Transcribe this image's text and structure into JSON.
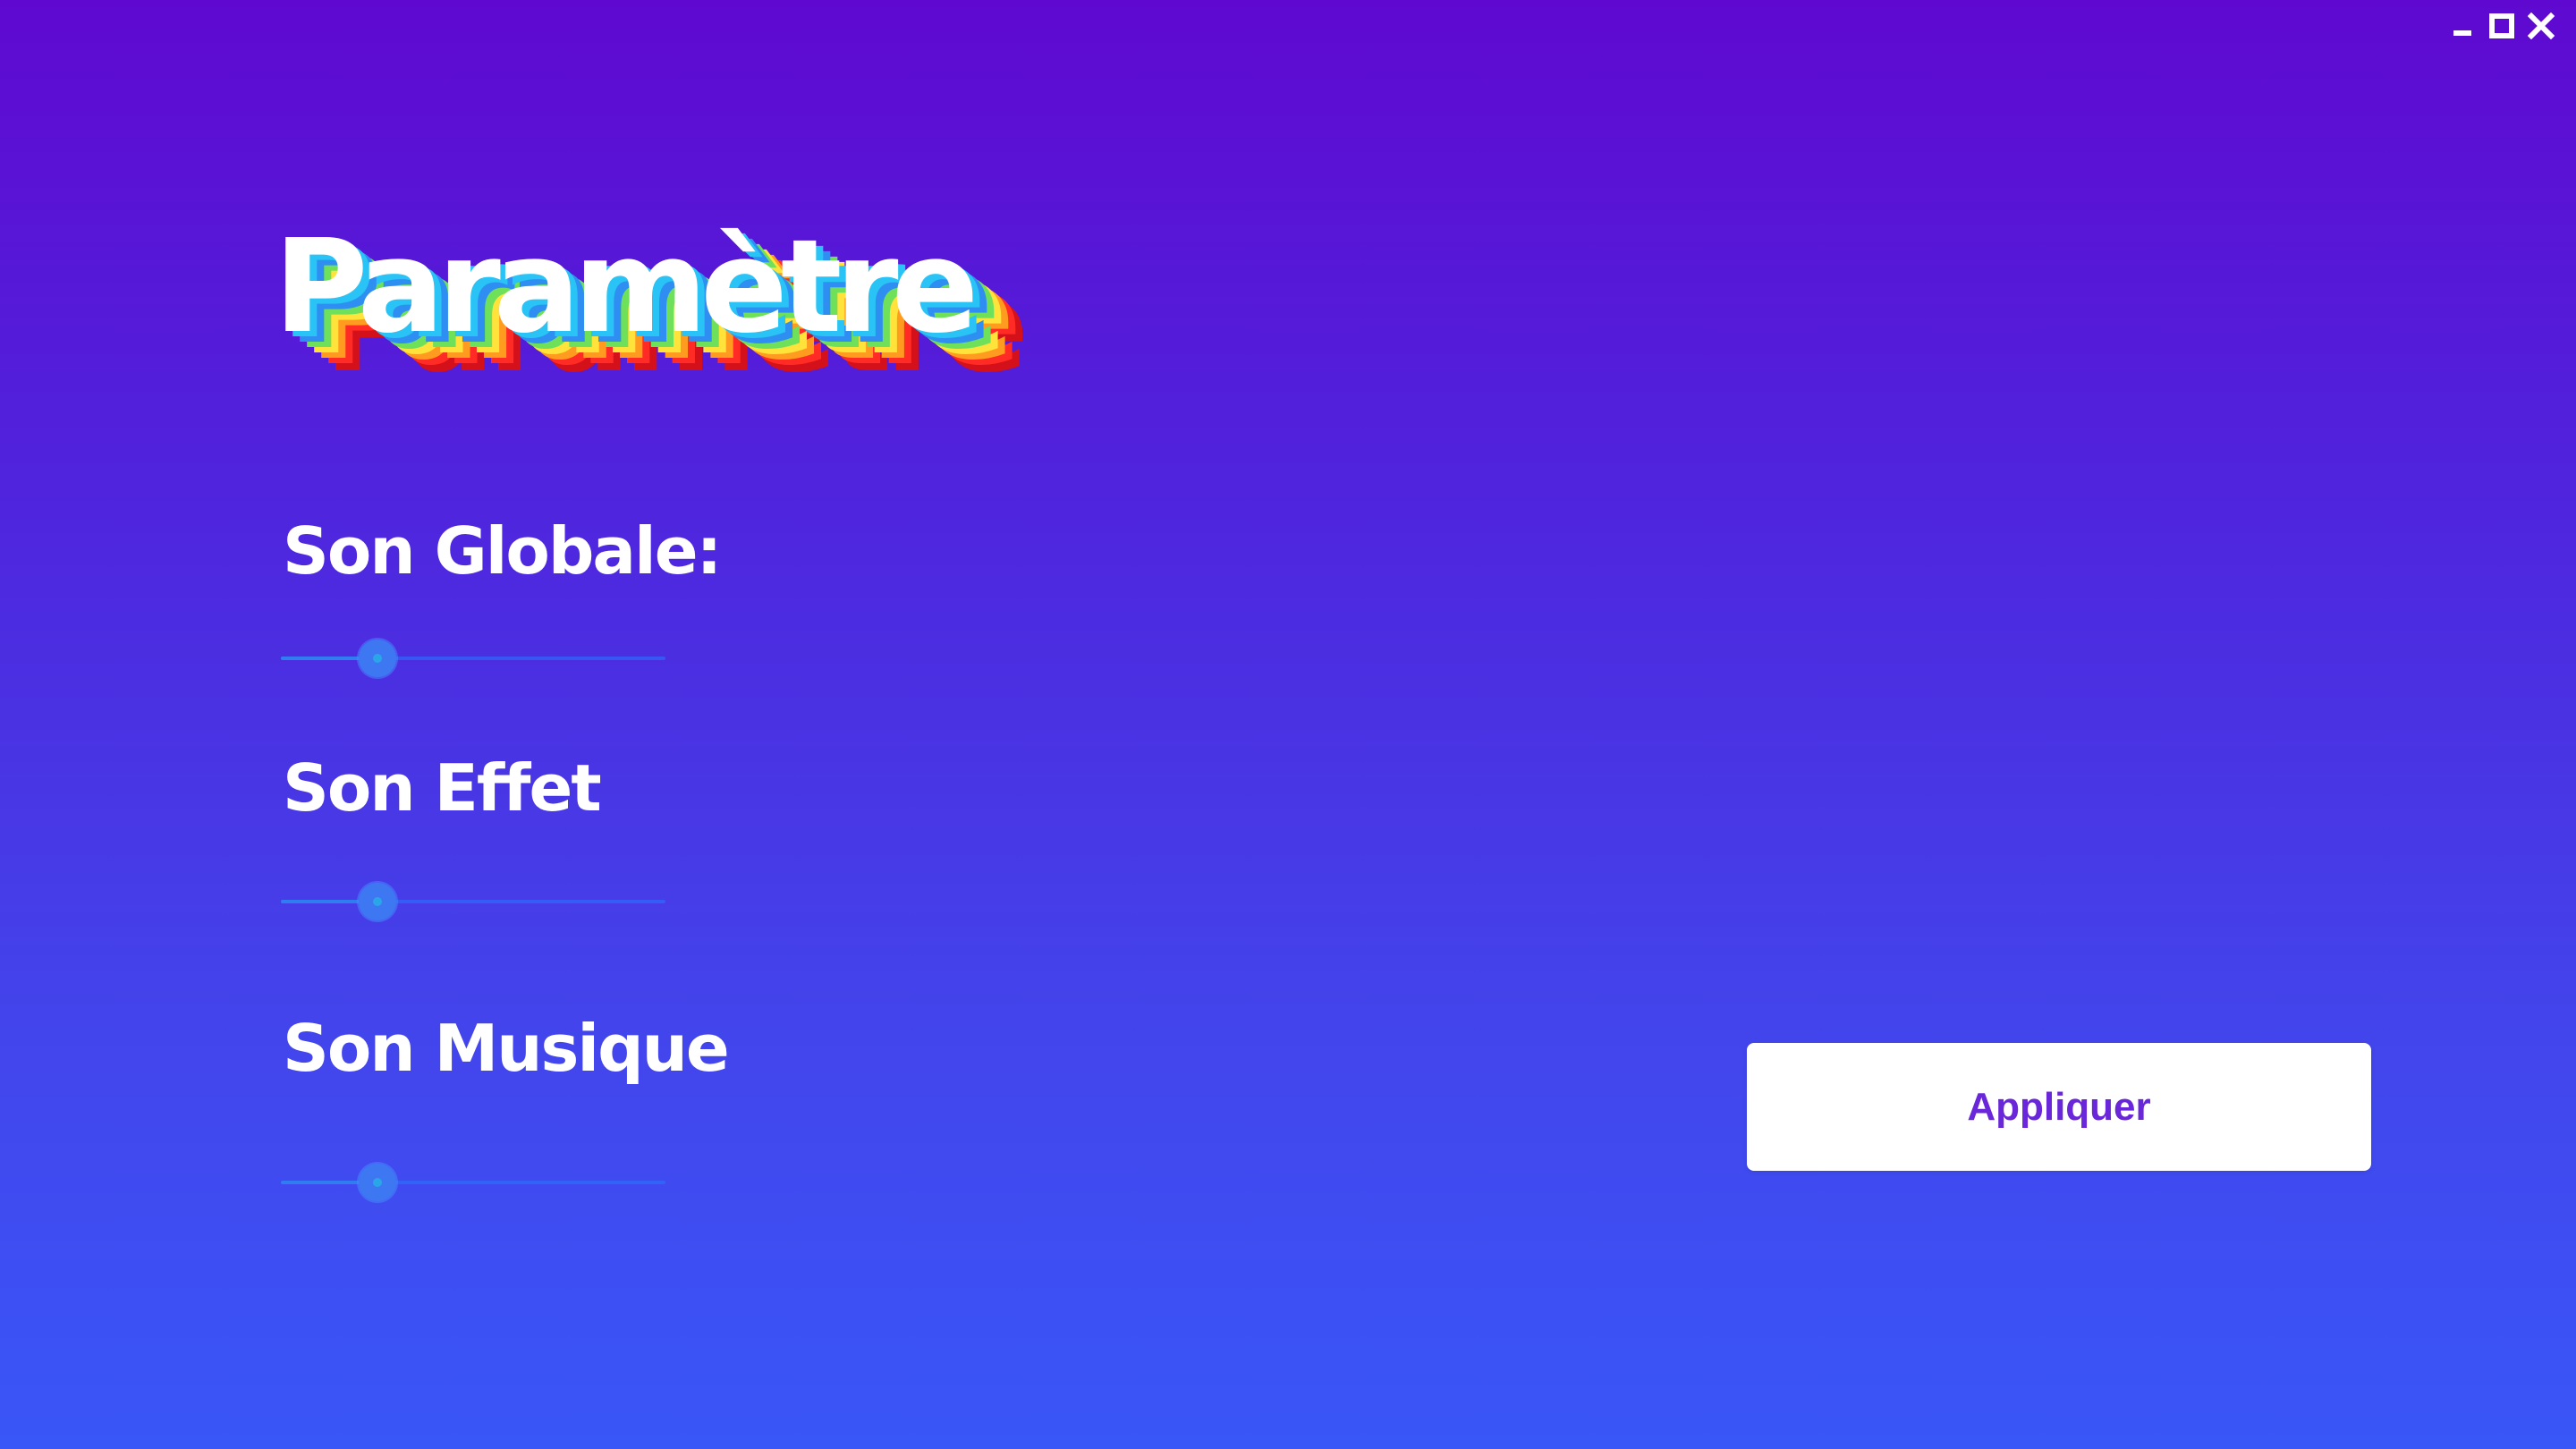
{
  "window": {
    "controls": [
      {
        "name": "minimize",
        "icon": "minimize-icon"
      },
      {
        "name": "maximize",
        "icon": "maximize-icon"
      },
      {
        "name": "close",
        "icon": "close-icon"
      }
    ]
  },
  "page": {
    "title": "Paramètre"
  },
  "settings": {
    "globale": {
      "label": "Son Globale:",
      "value": 0.25
    },
    "effet": {
      "label": "Son Effet",
      "value": 0.25
    },
    "musique": {
      "label": "Son Musique",
      "value": 0.25
    }
  },
  "actions": {
    "apply_label": "Appliquer"
  },
  "colors": {
    "background_top": "#5f09d0",
    "background_bottom": "#3956f7",
    "accent_text": "#6a27d9",
    "slider_thumb": "#3d78f2"
  }
}
